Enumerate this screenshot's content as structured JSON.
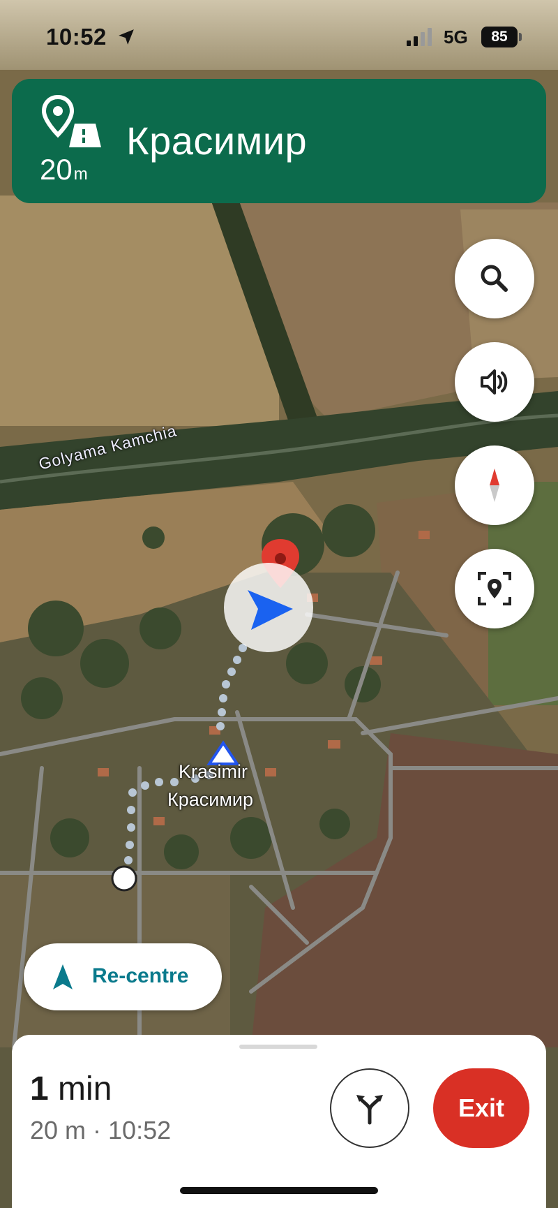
{
  "status_bar": {
    "time": "10:52",
    "network": "5G",
    "battery": "85",
    "icons": [
      "location-arrow-icon",
      "signal-icon"
    ]
  },
  "navigation": {
    "distance_value": "20",
    "distance_unit": "m",
    "street": "Красимир",
    "maneuver_icon": "destination-pin-icon",
    "banner_color": "#0c6b4c"
  },
  "side_buttons": [
    "search-icon",
    "volume-icon",
    "compass-icon",
    "location-report-icon"
  ],
  "map": {
    "river_label": "Golyama Kamchia",
    "place_label_latin": "Krasimir",
    "place_label_cyrillic": "Красимир"
  },
  "recentre": {
    "label": "Re-centre"
  },
  "trip": {
    "eta_number": "1",
    "eta_unit": "min",
    "details": "20 m · 10:52",
    "exit_label": "Exit",
    "accent_color": "#d93025"
  }
}
